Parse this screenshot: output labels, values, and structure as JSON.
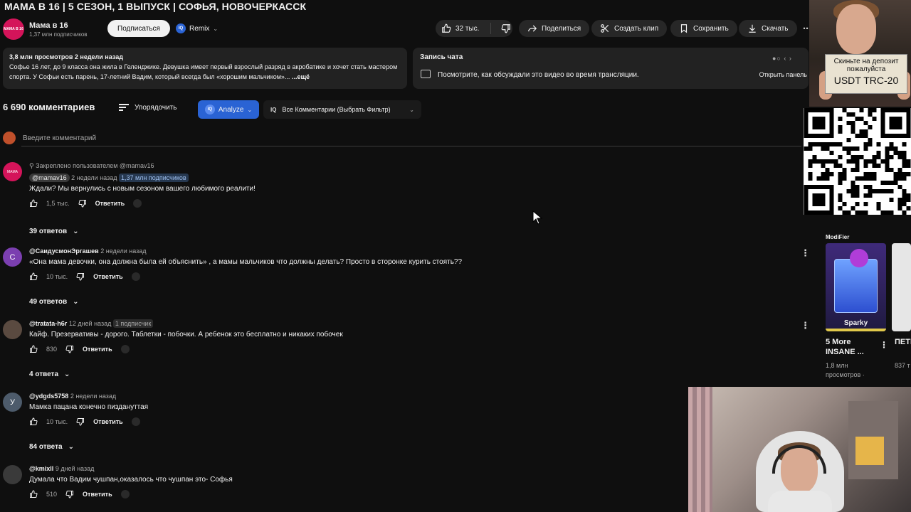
{
  "video": {
    "title": "МАМА В 16 | 5 СЕЗОН, 1 ВЫПУСК | СОФЬЯ, НОВОЧЕРКАССК"
  },
  "channel": {
    "name": "Мама в 16",
    "subscribers": "1,37 млн подписчиков",
    "avatar_text": "МАМА В 16",
    "subscribe_label": "Подписаться",
    "remix_label": "Remix"
  },
  "actions": {
    "likes": "32 тыс.",
    "share": "Поделиться",
    "clip": "Создать клип",
    "save": "Сохранить",
    "download": "Скачать"
  },
  "description": {
    "meta": "3,8 млн просмотров  2 недели назад",
    "text": "Софье 16 лет, до 9 класса она жила в Геленджике. Девушка имеет первый взрослый разряд в акробатике и хочет стать мастером спорта. У Софьи есть парень, 17-летний Вадим, который всегда был «хорошим мальчиком»...",
    "more": "...ещё"
  },
  "chat": {
    "title": "Запись чата",
    "text": "Посмотрите, как обсуждали это видео во время трансляции.",
    "open": "Открыть панель"
  },
  "comments": {
    "count_label": "6 690 комментариев",
    "sort_label": "Упорядочить",
    "analyze_label": "Analyze",
    "filter_label": "Все Комментарии (Выбрать Фильтр)",
    "add_placeholder": "Введите комментарий",
    "reply_label": "Ответить",
    "items": [
      {
        "pinned": "Закреплено пользователем @mamav16",
        "author": "@mamav16",
        "time": "2 недели назад",
        "subs": "1,37 млн подписчиков",
        "text": "Ждали? Мы вернулись с новым сезоном вашего любимого реалити!",
        "likes": "1,5 тыс.",
        "replies": "39 ответов"
      },
      {
        "avatar_letter": "С",
        "author": "@СаидусмонЭргашев",
        "time": "2 недели назад",
        "text": "«Она мама девочки, она должна была ей объяснить» , а мамы мальчиков что должны делать? Просто в сторонке курить стоять??",
        "likes": "10 тыс.",
        "replies": "49 ответов"
      },
      {
        "author": "@tratata-h6r",
        "time": "12 дней назад",
        "subs": "1 подписчик",
        "text": "Кайф. Презервативы - дорого. Таблетки - побочки. А ребенок это бесплатно и никаких побочек",
        "likes": "830",
        "replies": "4 ответа"
      },
      {
        "avatar_letter": "У",
        "author": "@ydgds5758",
        "time": "2 недели назад",
        "text": "Мамка пацана конечно пиздануттая",
        "likes": "10 тыс.",
        "replies": "84 ответа"
      },
      {
        "author": "@kmixll",
        "time": "9 дней назад",
        "text": "Думала что Вадим чушпан,оказалось что чушпан это- Софья",
        "likes": "510"
      }
    ]
  },
  "overlay": {
    "sign_line1": "Скиньте на депозит",
    "sign_line2": "пожалуйста",
    "sign_line3": "USDT TRC-20"
  },
  "sidebar": {
    "ad_label": "ModiFier",
    "ad_name": "Sparky",
    "rec1_title": "5 More INSANE ...",
    "rec1_meta1": "1,8 млн",
    "rec1_meta2": "просмотров ·",
    "rec2_title": "ПЕТЬ пока",
    "rec2_meta": "837 т"
  }
}
